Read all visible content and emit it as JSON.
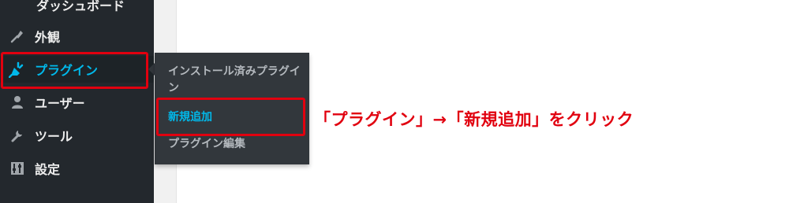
{
  "sidebar": {
    "cut_off_label": "ダッシュボード",
    "items": [
      {
        "label": "外観",
        "icon": "paintbrush-icon"
      },
      {
        "label": "プラグイン",
        "icon": "plug-icon",
        "active": true
      },
      {
        "label": "ユーザー",
        "icon": "user-icon"
      },
      {
        "label": "ツール",
        "icon": "wrench-icon"
      },
      {
        "label": "設定",
        "icon": "settings-icon"
      }
    ]
  },
  "flyout": {
    "items": [
      {
        "label": "インストール済みプラグイン"
      },
      {
        "label": "新規追加",
        "current": true
      },
      {
        "label": "プラグイン編集"
      }
    ]
  },
  "annotation": {
    "text": "「プラグイン」→「新規追加」をクリック"
  },
  "colors": {
    "sidebar_bg": "#23282d",
    "flyout_bg": "#32373c",
    "accent": "#00b9eb",
    "highlight": "#e1000f"
  }
}
